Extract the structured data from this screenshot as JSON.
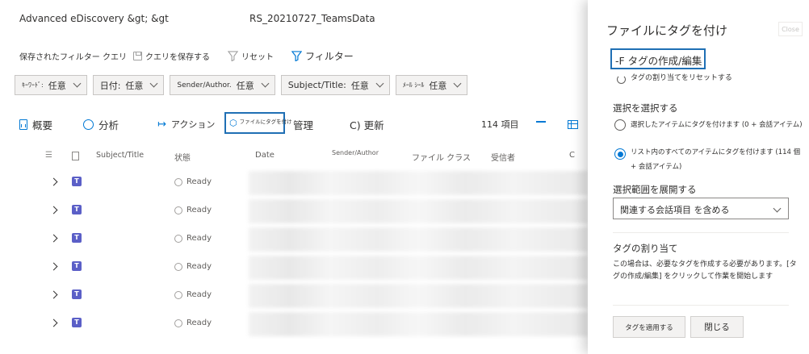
{
  "breadcrumb": {
    "app": "Advanced eDiscovery &gt; &gt",
    "case": "RS_20210727_TeamsData"
  },
  "commandbar": {
    "saved_queries": "保存されたフィルター クエリ",
    "save_query": "クエリを保存する",
    "reset": "リセット",
    "filter": "フィルター"
  },
  "filters": [
    {
      "label": "ｷｰﾜｰﾄﾞ:",
      "value": "任意"
    },
    {
      "label": "日付:",
      "value": "任意"
    },
    {
      "label": "Sender/Author.",
      "value": "任意"
    },
    {
      "label": "Subject/Title:",
      "value": "任意"
    },
    {
      "label": "ﾒｰﾙ ｼｰﾙ",
      "value": "任意"
    }
  ],
  "toolbar": {
    "overview": "概要",
    "analysis": "分析",
    "action": "アクション",
    "tag_files": "ファイルにタグを付け",
    "manage": "管理",
    "refresh": "C) 更新",
    "item_count": "114 項目"
  },
  "table": {
    "columns": {
      "subject": "Subject/Title",
      "state": "状態",
      "date": "Date",
      "sender": "Sender/Author",
      "file_class": "ファイル クラス",
      "recipients": "受信者",
      "more": "C"
    },
    "rows": [
      {
        "status": "Ready"
      },
      {
        "status": "Ready"
      },
      {
        "status": "Ready"
      },
      {
        "status": "Ready"
      },
      {
        "status": "Ready"
      },
      {
        "status": "Ready"
      }
    ]
  },
  "panel": {
    "title": "ファイルにタグを付け",
    "close_top": "Close",
    "create_edit_link": "-F タグの作成/編集",
    "reset_tags": "タグの割り当てをリセットする",
    "select_heading": "選択を選択する",
    "option_selected_items": "選択したアイテムにタグを付けます (0 + 会話アイテム)",
    "option_all_items": "リスト内のすべてのアイテムにタグを付けます (114 個 + 会話アイテム)",
    "expand_heading": "選択範囲を展開する",
    "expand_value": "関連する会話項目 を含める",
    "assign_heading": "タグの割り当て",
    "assign_note": "この場合は、必要なタグを作成する必要があります。[タグの作成/編集] をクリックして作業を開始します",
    "apply_button": "タグを適用する",
    "close_button": "閉じる"
  },
  "colors": {
    "accent": "#0078d4",
    "highlight_border": "#1f6fb4",
    "teams": "#5b5fc7"
  }
}
